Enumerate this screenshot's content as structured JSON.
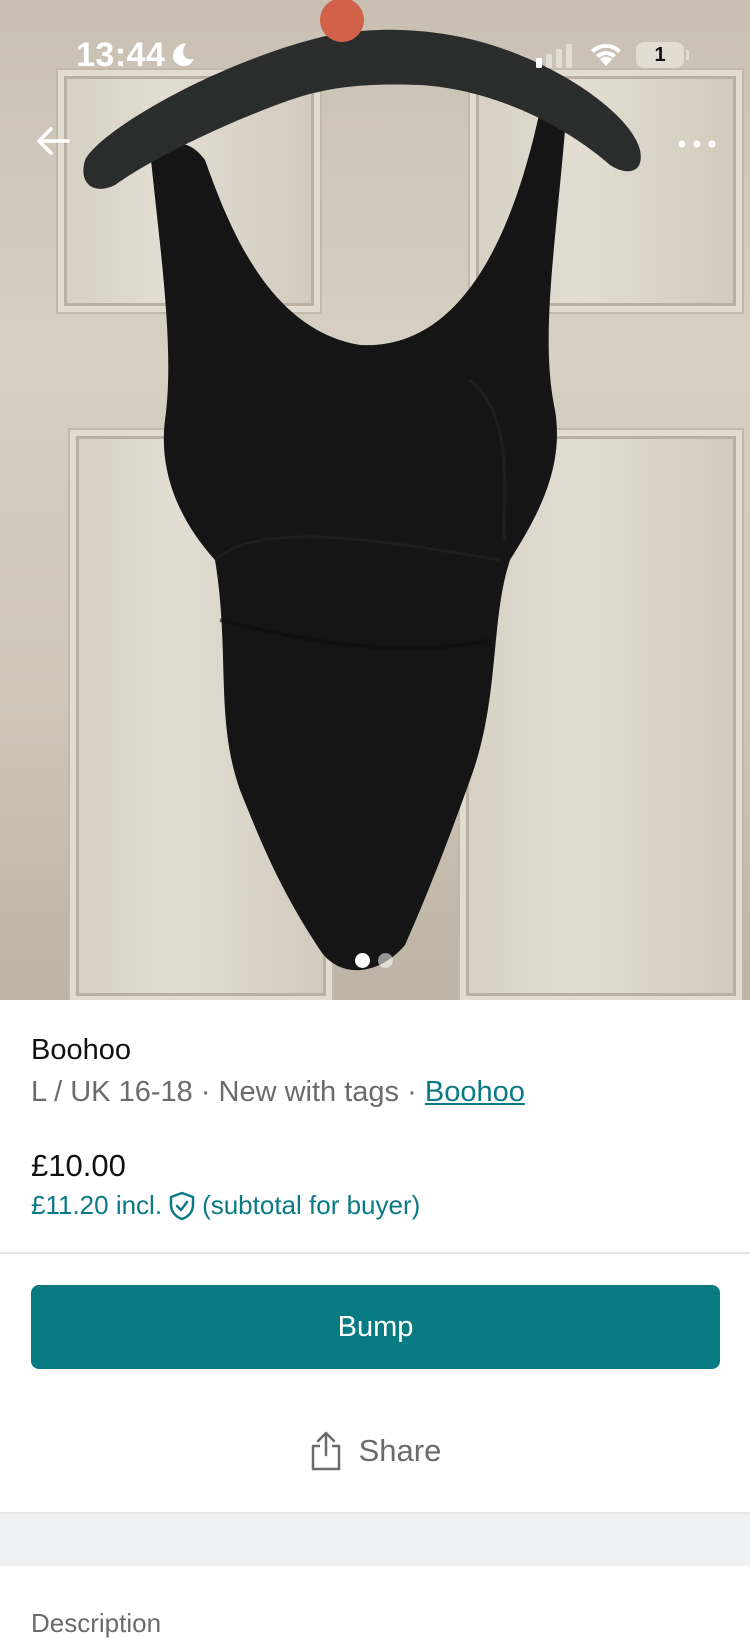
{
  "status_bar": {
    "time": "13:44",
    "battery": "1"
  },
  "listing": {
    "title": "Boohoo",
    "size": "L / UK 16-18",
    "condition": "New with tags",
    "brand": "Boohoo",
    "separator": "·",
    "price": "£10.00",
    "price_incl": "£11.20 incl.",
    "price_incl_note": "(subtotal for buyer)"
  },
  "photo": {
    "current": 1,
    "total": 2
  },
  "actions": {
    "bump": "Bump",
    "share": "Share"
  },
  "sections": {
    "description": "Description"
  },
  "colors": {
    "accent": "#087a82",
    "link": "#0a7a86"
  }
}
